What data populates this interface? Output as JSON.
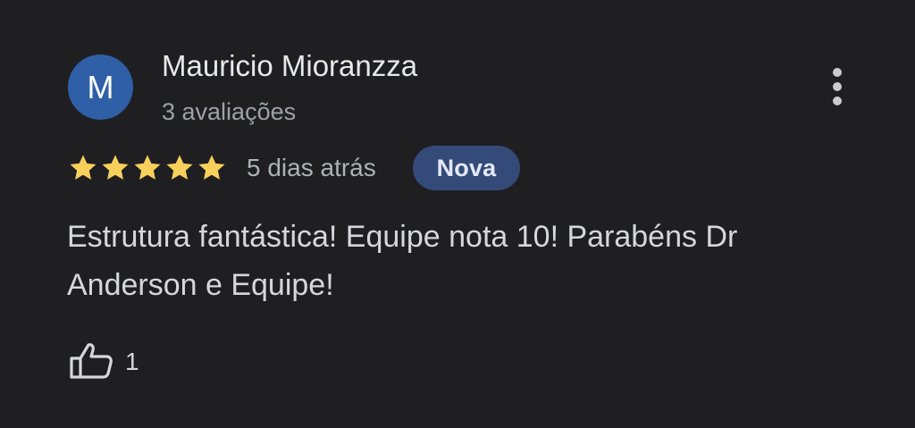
{
  "reviewer": {
    "initial": "M",
    "name": "Mauricio Mioranzza",
    "review_count": "3 avaliações",
    "avatar_color": "#2f5fa7"
  },
  "rating": {
    "stars": 5,
    "max_stars": 5,
    "star_color": "#f7cf5b"
  },
  "review": {
    "date": "5 dias atrás",
    "badge": "Nova",
    "text": "Estrutura fantástica! Equipe nota 10! Parabéns Dr Anderson e Equipe!"
  },
  "actions": {
    "more_icon": "more-vert-icon",
    "like_icon": "thumb-up-icon",
    "like_count": "1"
  }
}
